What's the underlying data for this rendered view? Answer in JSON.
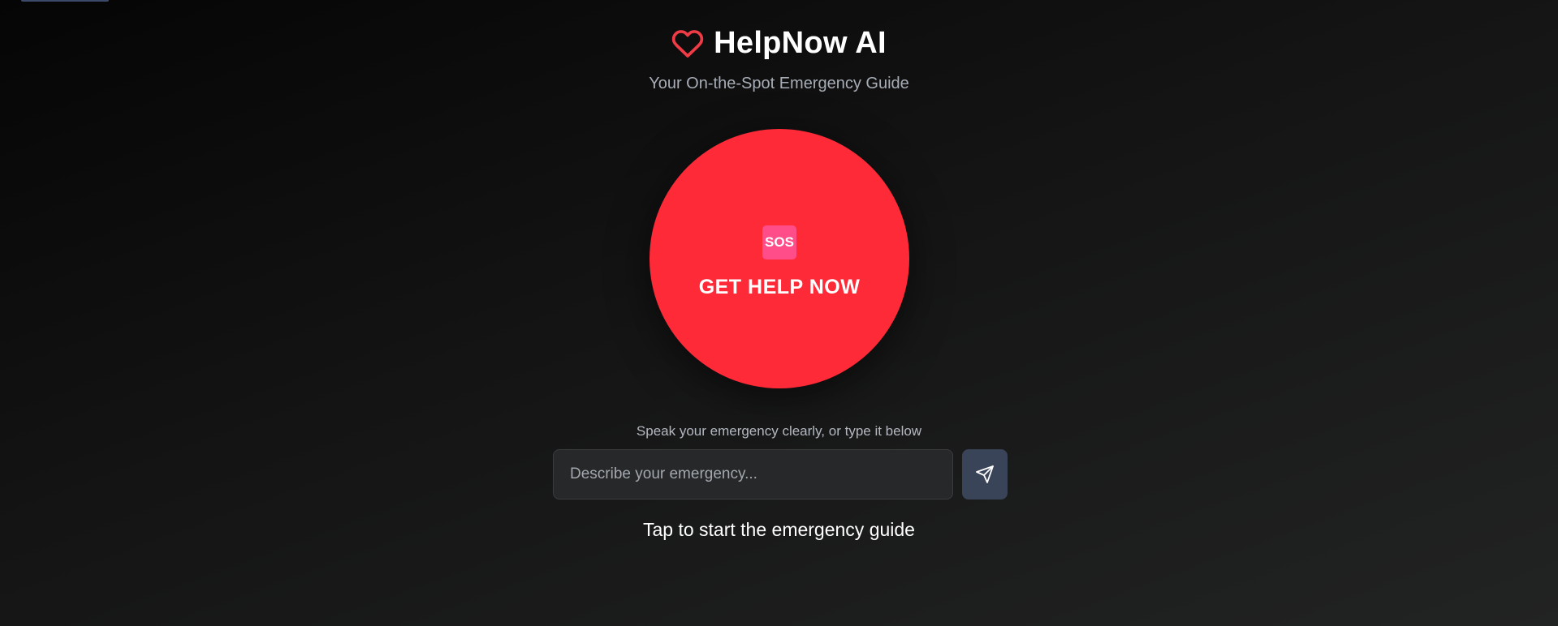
{
  "app": {
    "title": "HelpNow AI",
    "subtitle": "Your On-the-Spot Emergency Guide"
  },
  "sos": {
    "icon_text": "SOS",
    "label": "GET HELP NOW"
  },
  "input": {
    "hint": "Speak your emergency clearly, or type it below",
    "placeholder": "Describe your emergency...",
    "value": ""
  },
  "footer": {
    "tap_text": "Tap to start the emergency guide"
  },
  "icons": {
    "heart": "heart-icon",
    "sos": "sos-icon",
    "send": "send-icon"
  },
  "colors": {
    "accent_red": "#ff2a38",
    "heart_red": "#ef3b45",
    "sos_badge": "#ff4d8a",
    "send_button": "#3a4458",
    "background_dark": "#050505",
    "background_light": "#222323"
  }
}
